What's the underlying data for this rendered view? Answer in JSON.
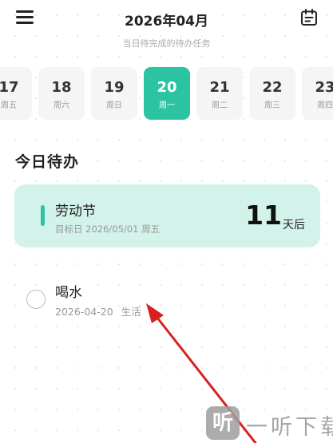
{
  "header": {
    "title": "2026年04月",
    "subtitle": "当日待完成的待办任务"
  },
  "dates": [
    {
      "day": "17",
      "weekday": "周五"
    },
    {
      "day": "18",
      "weekday": "周六"
    },
    {
      "day": "19",
      "weekday": "周日"
    },
    {
      "day": "20",
      "weekday": "周一",
      "selected": true
    },
    {
      "day": "21",
      "weekday": "周二"
    },
    {
      "day": "22",
      "weekday": "周三"
    },
    {
      "day": "23",
      "weekday": "周四"
    }
  ],
  "section": {
    "title": "今日待办"
  },
  "event": {
    "name": "劳动节",
    "target_date": "目标日 2026/05/01 周五",
    "days": "11",
    "unit": "天后"
  },
  "task": {
    "name": "喝水",
    "date": "2026-04-20",
    "tag": "生活"
  },
  "watermark": {
    "logo_char": "听",
    "text": "一听下载"
  },
  "colors": {
    "accent": "#2cc3a3",
    "card_bg": "#d3f2ea",
    "arrow": "#d92020"
  }
}
